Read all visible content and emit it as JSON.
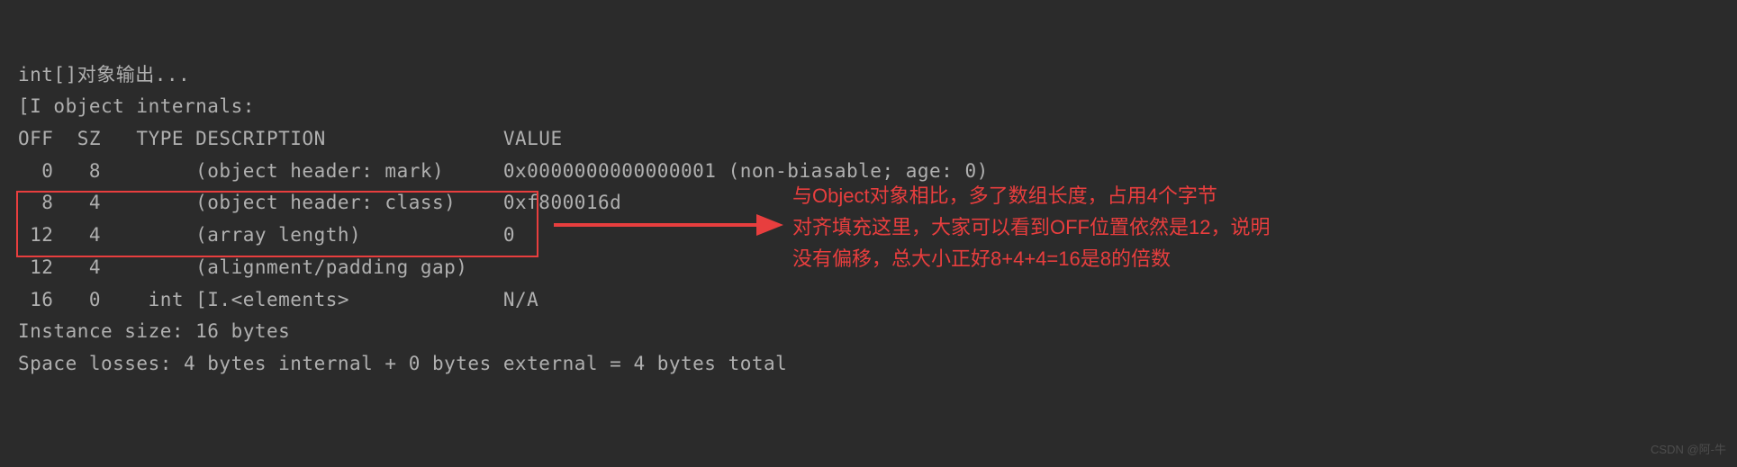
{
  "console": {
    "line1": "int[]对象输出...",
    "line2": "[I object internals:",
    "header": "OFF  SZ   TYPE DESCRIPTION               VALUE",
    "row0": "  0   8        (object header: mark)     0x0000000000000001 (non-biasable; age: 0)",
    "row1": "  8   4        (object header: class)    0xf800016d",
    "row2": " 12   4        (array length)            0",
    "row3": " 12   4        (alignment/padding gap)   ",
    "row4": " 16   0    int [I.<elements>             N/A",
    "instance_size": "Instance size: 16 bytes",
    "space_losses": "Space losses: 4 bytes internal + 0 bytes external = 4 bytes total"
  },
  "annotation": {
    "line1": "与Object对象相比，多了数组长度，占用4个字节",
    "line2": "对齐填充这里，大家可以看到OFF位置依然是12，说明",
    "line3": "没有偏移，总大小正好8+4+4=16是8的倍数"
  },
  "watermark": "CSDN @阿-牛"
}
